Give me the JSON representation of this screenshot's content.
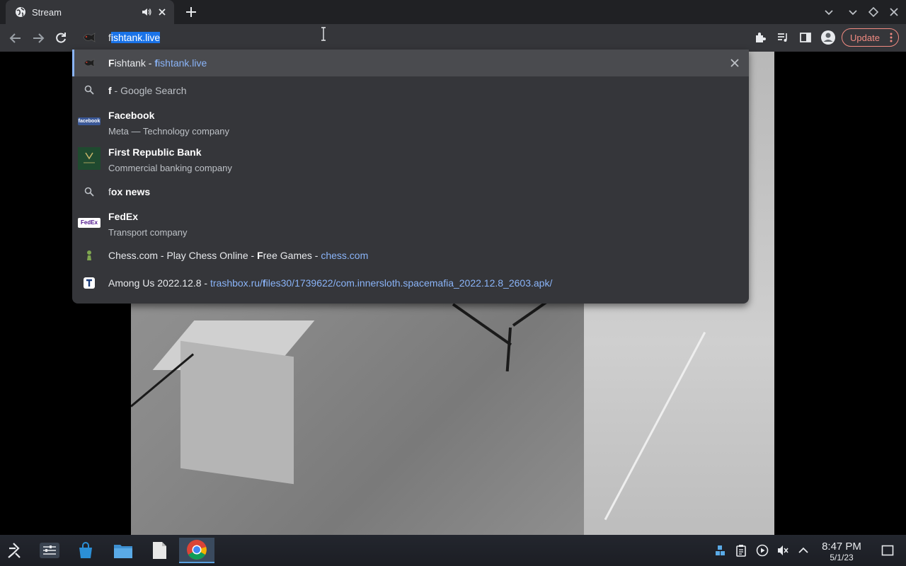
{
  "tab": {
    "title": "Stream"
  },
  "omnibox": {
    "typed": "f",
    "autocomplete": "ishtank.live"
  },
  "toolbar": {
    "update_label": "Update"
  },
  "suggestions": [
    {
      "type": "site",
      "title_bold": "F",
      "title_rest": "ishtank",
      "sep": " - ",
      "url_bold": "f",
      "url_rest": "ishtank.live"
    },
    {
      "type": "search",
      "query": "f",
      "suffix": " - Google Search"
    },
    {
      "type": "entity",
      "title_bold": "F",
      "title_rest": "acebook",
      "subtitle": "Meta — Technology company"
    },
    {
      "type": "entity",
      "title_bold": "F",
      "title_rest": "irst Republic Bank",
      "subtitle": "Commercial banking company"
    },
    {
      "type": "search",
      "query_bold": "f",
      "query_rest": "ox news"
    },
    {
      "type": "entity",
      "title_bold": "F",
      "title_rest": "edEx",
      "subtitle": "Transport company"
    },
    {
      "type": "history",
      "text_a": "Chess.com - Play Chess Online - ",
      "text_b": "F",
      "text_c": "ree Games",
      "sep": " - ",
      "url": "chess.com"
    },
    {
      "type": "history",
      "text_a": "Among Us 2022.12.8",
      "sep": " - ",
      "url_a": "trashbox.ru/",
      "url_b": "f",
      "url_c": "iles30/1739622/com.innersloth.spacemafia_2022.12.8_2603.apk/"
    }
  ],
  "icons": {
    "facebook_logo_text": "facebook",
    "fedex_logo_text": "FedEx"
  },
  "clock": {
    "time": "8:47 PM",
    "date": "5/1/23"
  },
  "colors": {
    "accent": "#8ab4f8",
    "update": "#f28b82",
    "selection": "#1a73e8"
  }
}
